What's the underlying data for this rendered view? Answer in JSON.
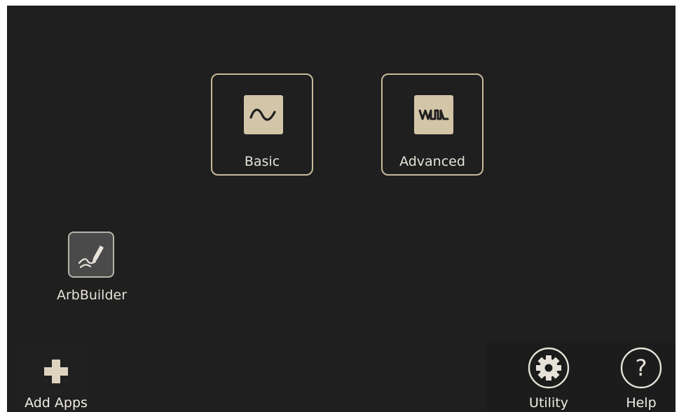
{
  "tiles": {
    "basic": {
      "label": "Basic",
      "icon": "sine-wave-icon"
    },
    "advanced": {
      "label": "Advanced",
      "icon": "pulse-wave-icon"
    }
  },
  "apps": {
    "arbbuilder": {
      "label": "ArbBuilder",
      "icon": "pen-draw-icon"
    }
  },
  "bottom_bar": {
    "add_apps": {
      "label": "Add Apps",
      "icon": "plus-icon"
    },
    "utility": {
      "label": "Utility",
      "icon": "gear-icon"
    },
    "help": {
      "label": "Help",
      "icon": "question-icon"
    }
  },
  "colors": {
    "background": "#1f1f1f",
    "accent": "#c8b99a",
    "tile_icon_bg": "#d3c5a8",
    "text": "#e6e2d8"
  }
}
